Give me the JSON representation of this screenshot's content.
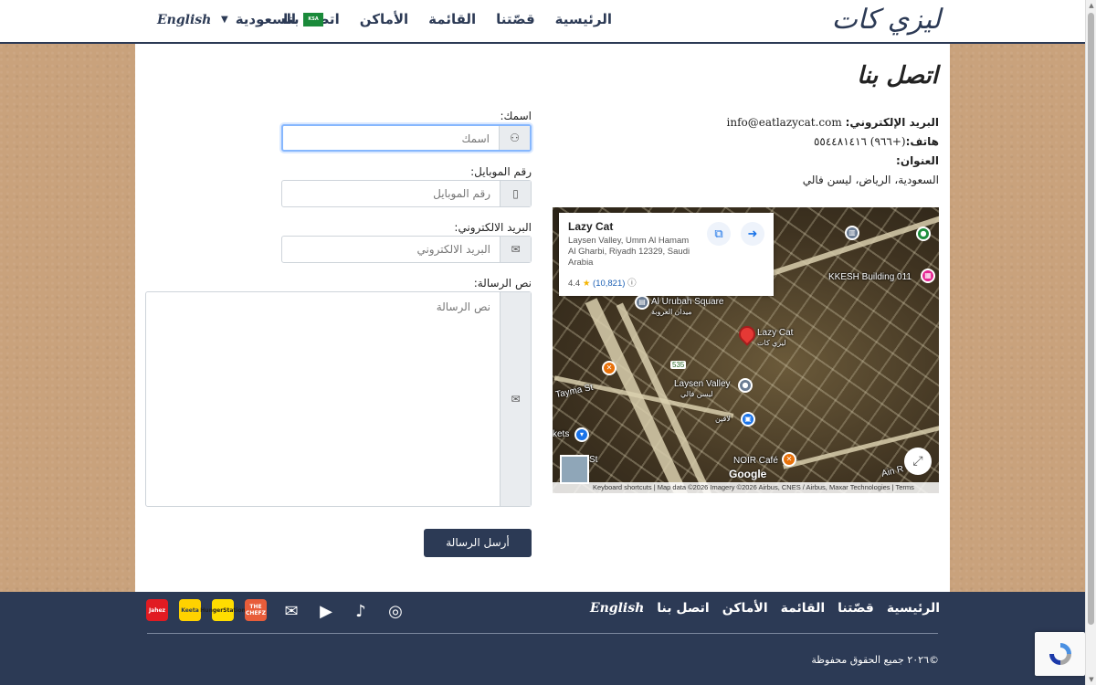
{
  "header": {
    "logo": "ليزي كات",
    "nav": [
      "الرئيسية",
      "قصّتنا",
      "القائمة",
      "الأماكن",
      "اتصل بنا"
    ],
    "country": "السعودية",
    "flag_text": "KSA",
    "language": "English"
  },
  "page": {
    "title": "اتصل بنا"
  },
  "contact": {
    "email_label": "البريد الإلكتروني:",
    "email": "info@eatlazycat.com",
    "phone_label": "هاتف:",
    "phone": "(+٩٦٦) ٥٥٤٤٨١٤١٦",
    "address_label": "العنوان:",
    "address": "السعودية، الرياض، ليسن فالي"
  },
  "map": {
    "place_name": "Lazy Cat",
    "place_address": "Laysen Valley, Umm Al Hamam Al Gharbi, Riyadh 12329, Saudi Arabia",
    "rating": "4.4",
    "reviews": "(10,821)",
    "labels": {
      "urubah": "Al Urubah Square",
      "urubah_ar": "ميدان العروبة",
      "kkesh": "KKESH Building 011",
      "lazycat": "Lazy Cat",
      "lazycat_ar": "ليزي كات",
      "laysen": "Laysen Valley",
      "laysen_ar": "ليسن فالي",
      "noir": "NOIR Café",
      "road": "535",
      "tayma": "Tayma St",
      "ain": "Ain R",
      "kets": "kets",
      "st": "St",
      "lafine": "لافين"
    },
    "google": "Google",
    "footer": "Keyboard shortcuts  |  Map data ©2026 Imagery ©2026 Airbus, CNES / Airbus, Maxar Technologies  |  Terms"
  },
  "form": {
    "name_label": "اسمك:",
    "name_placeholder": "اسمك",
    "mobile_label": "رقم الموبايل:",
    "mobile_placeholder": "رقم الموبايل",
    "email_label": "البريد الالكتروني:",
    "email_placeholder": "البريد الالكتروني",
    "message_label": "نص الرسالة:",
    "message_placeholder": "نص الرسالة",
    "submit": "أرسل الرسالة"
  },
  "footer": {
    "nav": [
      "الرئيسية",
      "قصّتنا",
      "القائمة",
      "الأماكن",
      "اتصل بنا"
    ],
    "language": "English",
    "apps": [
      "Jahez",
      "Keeta",
      "HungerStation",
      "THE CHEFZ"
    ],
    "copyright": "©٢٠٢٦ جميع الحقوق محفوظة"
  },
  "colors": {
    "brand": "#2c3a55",
    "background": "#c9a27c"
  }
}
